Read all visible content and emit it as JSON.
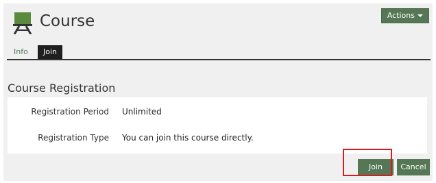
{
  "header": {
    "title": "Course",
    "icon": "easel-icon",
    "actions_label": "Actions"
  },
  "tabs": [
    {
      "label": "Info",
      "active": false
    },
    {
      "label": "Join",
      "active": true
    }
  ],
  "section": {
    "title": "Course Registration",
    "rows": [
      {
        "label": "Registration Period",
        "value": "Unlimited"
      },
      {
        "label": "Registration Type",
        "value": "You can join this course directly."
      }
    ]
  },
  "footer": {
    "join_label": "Join",
    "cancel_label": "Cancel"
  },
  "colors": {
    "accent": "#557755",
    "active_tab": "#1f1f1f",
    "highlight": "#e0181e"
  }
}
